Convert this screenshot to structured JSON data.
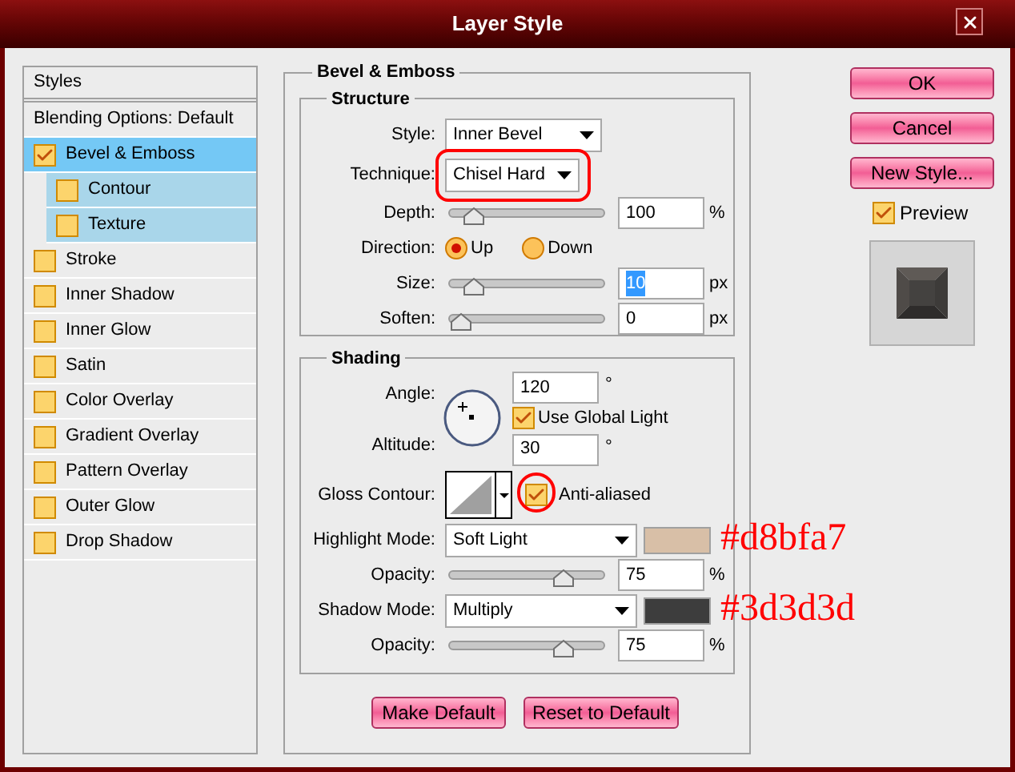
{
  "window": {
    "title": "Layer Style"
  },
  "styles_list": {
    "header": "Styles",
    "items": [
      {
        "label": "Blending Options: Default",
        "kind": "plain",
        "selected": false
      },
      {
        "label": "Bevel & Emboss",
        "kind": "check",
        "checked": true,
        "selected": true,
        "children": [
          {
            "label": "Contour",
            "checked": false
          },
          {
            "label": "Texture",
            "checked": false
          }
        ]
      },
      {
        "label": "Stroke",
        "kind": "check",
        "checked": false,
        "selected": false
      },
      {
        "label": "Inner Shadow",
        "kind": "check",
        "checked": false,
        "selected": false
      },
      {
        "label": "Inner Glow",
        "kind": "check",
        "checked": false,
        "selected": false
      },
      {
        "label": "Satin",
        "kind": "check",
        "checked": false,
        "selected": false
      },
      {
        "label": "Color Overlay",
        "kind": "check",
        "checked": false,
        "selected": false
      },
      {
        "label": "Gradient Overlay",
        "kind": "check",
        "checked": false,
        "selected": false
      },
      {
        "label": "Pattern Overlay",
        "kind": "check",
        "checked": false,
        "selected": false
      },
      {
        "label": "Outer Glow",
        "kind": "check",
        "checked": false,
        "selected": false
      },
      {
        "label": "Drop Shadow",
        "kind": "check",
        "checked": false,
        "selected": false
      }
    ]
  },
  "bevel_emboss": {
    "title": "Bevel & Emboss",
    "structure": {
      "title": "Structure",
      "style": {
        "label": "Style:",
        "value": "Inner Bevel"
      },
      "technique": {
        "label": "Technique:",
        "value": "Chisel Hard",
        "circled": true
      },
      "depth": {
        "label": "Depth:",
        "level": 0.1,
        "value": "100",
        "unit": "%"
      },
      "direction": {
        "label": "Direction:",
        "options": [
          {
            "label": "Up",
            "selected": true
          },
          {
            "label": "Down",
            "selected": false
          }
        ]
      },
      "size": {
        "label": "Size:",
        "level": 0.1,
        "value": "10",
        "unit": "px",
        "value_selected": true
      },
      "soften": {
        "label": "Soften:",
        "level": 0,
        "value": "0",
        "unit": "px"
      }
    },
    "shading": {
      "title": "Shading",
      "angle": {
        "label": "Angle:",
        "value": "120",
        "unit": "°"
      },
      "use_global_light": {
        "label": "Use Global Light",
        "checked": true
      },
      "altitude": {
        "label": "Altitude:",
        "value": "30",
        "unit": "°"
      },
      "gloss_contour": {
        "label": "Gloss Contour:"
      },
      "anti_aliased": {
        "label": "Anti-aliased",
        "checked": true,
        "circled": true
      },
      "highlight_mode": {
        "label": "Highlight Mode:",
        "value": "Soft Light",
        "color": "#d8bfa7",
        "annotation": "#d8bfa7"
      },
      "highlight_opacity": {
        "label": "Opacity:",
        "level": 0.76,
        "value": "75",
        "unit": "%"
      },
      "shadow_mode": {
        "label": "Shadow Mode:",
        "value": "Multiply",
        "color": "#3d3d3d",
        "annotation": "#3d3d3d"
      },
      "shadow_opacity": {
        "label": "Opacity:",
        "level": 0.76,
        "value": "75",
        "unit": "%"
      }
    },
    "buttons": [
      "Make Default",
      "Reset to Default"
    ]
  },
  "actions": {
    "buttons": [
      "OK",
      "Cancel",
      "New Style..."
    ],
    "preview": {
      "label": "Preview",
      "checked": true
    }
  }
}
